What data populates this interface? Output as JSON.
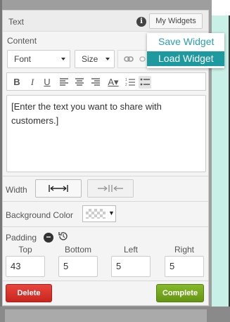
{
  "panel": {
    "title": "Text",
    "my_widgets_label": "My Widgets",
    "info_icon": "info-icon"
  },
  "dropdown": {
    "items": [
      {
        "label": "Save Widget"
      },
      {
        "label": "Load Widget",
        "highlighted": true
      }
    ]
  },
  "content": {
    "label": "Content",
    "font_select": "Font",
    "size_select": "Size",
    "editor_text": "[Enter the text you want to share with customers.]"
  },
  "width": {
    "label": "Width",
    "full_icon": "stretch-width-icon",
    "narrow_icon": "shrink-width-icon"
  },
  "background_color": {
    "label": "Background Color",
    "caret": "▼"
  },
  "padding": {
    "label": "Padding",
    "fields": [
      {
        "label": "Top",
        "value": "43"
      },
      {
        "label": "Bottom",
        "value": "5"
      },
      {
        "label": "Left",
        "value": "5"
      },
      {
        "label": "Right",
        "value": "5"
      }
    ]
  },
  "actions": {
    "delete_label": "Delete",
    "complete_label": "Complete"
  },
  "colors": {
    "accent": "#1d9a9f",
    "delete": "#d9342b",
    "complete": "#76a720"
  }
}
